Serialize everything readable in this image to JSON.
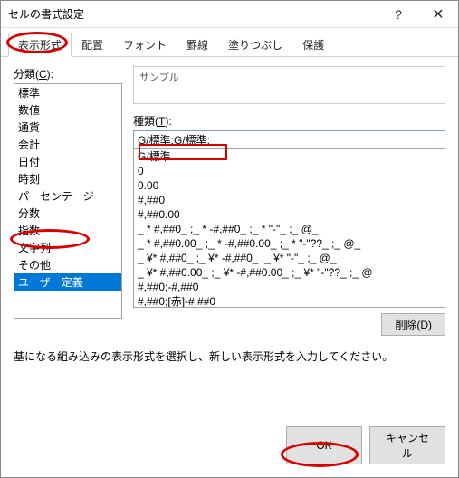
{
  "titlebar": {
    "title": "セルの書式設定"
  },
  "tabs": [
    {
      "label": "表示形式",
      "active": true
    },
    {
      "label": "配置"
    },
    {
      "label": "フォント"
    },
    {
      "label": "罫線"
    },
    {
      "label": "塗りつぶし"
    },
    {
      "label": "保護"
    }
  ],
  "left": {
    "label": "分類(C):",
    "items": [
      "標準",
      "数値",
      "通貨",
      "会計",
      "日付",
      "時刻",
      "パーセンテージ",
      "分数",
      "指数",
      "文字列",
      "その他",
      "ユーザー定義"
    ],
    "selected": "ユーザー定義"
  },
  "right": {
    "sample_label": "サンプル",
    "type_label": "種類(T):",
    "type_value": "G/標準;G/標準;",
    "formats": [
      "G/標準",
      "0",
      "0.00",
      "#,##0",
      "#,##0.00",
      "_ * #,##0_ ;_ * -#,##0_ ;_ * \"-\"_ ;_ @_ ",
      "_ * #,##0.00_ ;_ * -#,##0.00_ ;_ * \"-\"??_ ;_ @_ ",
      "_ ¥* #,##0_ ;_ ¥* -#,##0_ ;_ ¥* \"-\"_ ;_ @_ ",
      "_ ¥* #,##0.00_ ;_ ¥* -#,##0.00_ ;_ ¥* \"-\"??_ ;_ @",
      "#,##0;-#,##0",
      "#,##0;[赤]-#,##0"
    ],
    "delete_label": "削除(D)"
  },
  "hint": "基になる組み込みの表示形式を選択し、新しい表示形式を入力してください。",
  "footer": {
    "ok": "OK",
    "cancel": "キャンセル"
  }
}
